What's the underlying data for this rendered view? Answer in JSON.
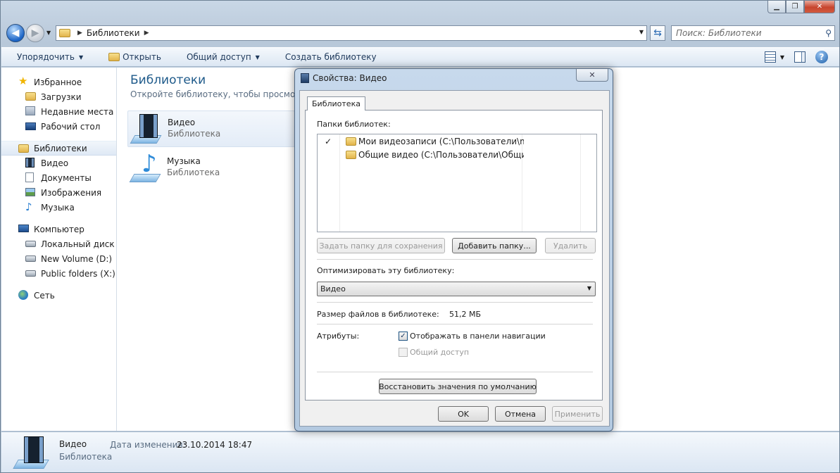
{
  "explorer": {
    "breadcrumb": "Библиотеки",
    "search_placeholder": "Поиск: Библиотеки",
    "toolbar": {
      "organize": "Упорядочить",
      "open": "Открыть",
      "share": "Общий доступ",
      "create_library": "Создать библиотеку"
    },
    "nav": {
      "favorites": "Избранное",
      "downloads": "Загрузки",
      "recent": "Недавние места",
      "desktop": "Рабочий стол",
      "libraries": "Библиотеки",
      "video": "Видео",
      "documents": "Документы",
      "images": "Изображения",
      "music": "Музыка",
      "computer": "Компьютер",
      "local_disk": "Локальный диск (C",
      "new_volume": "New Volume (D:)",
      "public_folders": "Public folders (X:)",
      "network": "Сеть"
    },
    "main": {
      "header": "Библиотеки",
      "subtitle": "Откройте библиотеку, чтобы просмотреть",
      "libraries": [
        {
          "name": "Видео",
          "type": "Библиотека"
        },
        {
          "name": "Музыка",
          "type": "Библиотека"
        }
      ]
    },
    "details": {
      "name": "Видео",
      "type": "Библиотека",
      "date_label": "Дата изменения:",
      "date_value": "23.10.2014 18:47"
    }
  },
  "dialog": {
    "title": "Свойства: Видео",
    "tab": "Библиотека",
    "folders_label": "Папки библиотек:",
    "folders": [
      {
        "checked": "✓",
        "path": "Мои видеозаписи (C:\\Пользователи\\m_"
      },
      {
        "checked": "",
        "path": "Общие видео (C:\\Пользователи\\Общие)"
      }
    ],
    "set_save_button": "Задать папку для сохранения",
    "add_folder_button": "Добавить папку...",
    "remove_button": "Удалить",
    "optimize_label": "Оптимизировать эту библиотеку:",
    "optimize_value": "Видео",
    "size_label": "Размер файлов в библиотеке:",
    "size_value": "51,2 МБ",
    "attributes_label": "Атрибуты:",
    "show_in_nav_label": "Отображать в панели навигации",
    "show_in_nav_checked": "✓",
    "shared_label": "Общий доступ",
    "restore_button": "Восстановить значения по умолчанию",
    "ok_button": "OK",
    "cancel_button": "Отмена",
    "apply_button": "Применить"
  }
}
